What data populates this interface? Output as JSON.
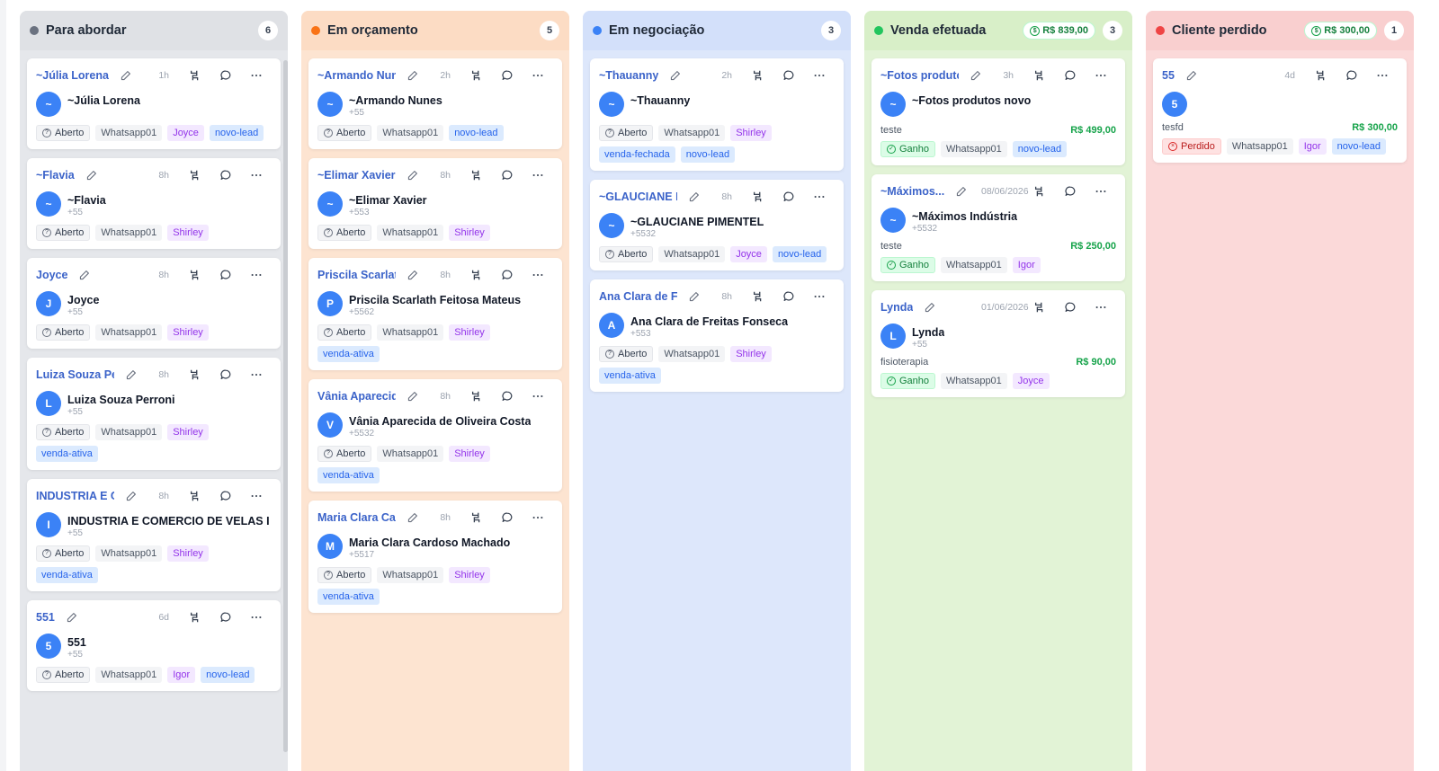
{
  "columns": [
    {
      "title": "Para abordar",
      "count": "6",
      "total": "",
      "dot_color": "#6b7280",
      "bg": "#e5e7eb",
      "head_bg": "#dfe1e5",
      "cards": [
        {
          "name": "~Júlia Lorena",
          "time": "1h",
          "avatar": "~",
          "contact": "~Júlia Lorena",
          "phone": "",
          "status": "Aberto",
          "connection": "Whatsapp01",
          "tags": [
            {
              "text": "Joyce",
              "kind": "user"
            },
            {
              "text": "novo-lead",
              "kind": "label"
            }
          ]
        },
        {
          "name": "~Flavia",
          "time": "8h",
          "avatar": "~",
          "contact": "~Flavia",
          "phone": "+55",
          "status": "Aberto",
          "connection": "Whatsapp01",
          "tags": [
            {
              "text": "Shirley",
              "kind": "user"
            }
          ]
        },
        {
          "name": "Joyce",
          "time": "8h",
          "avatar": "J",
          "contact": "Joyce",
          "phone": "+55",
          "status": "Aberto",
          "connection": "Whatsapp01",
          "tags": [
            {
              "text": "Shirley",
              "kind": "user"
            }
          ]
        },
        {
          "name": "Luiza Souza Perr...",
          "time": "8h",
          "avatar": "L",
          "contact": "Luiza Souza Perroni",
          "phone": "+55",
          "status": "Aberto",
          "connection": "Whatsapp01",
          "tags": [
            {
              "text": "Shirley",
              "kind": "user"
            },
            {
              "text": "venda-ativa",
              "kind": "label"
            }
          ]
        },
        {
          "name": "INDUSTRIA E CO...",
          "time": "8h",
          "avatar": "I",
          "contact": "INDUSTRIA E COMERCIO DE VELAS IR...",
          "phone": "+55",
          "status": "Aberto",
          "connection": "Whatsapp01",
          "tags": [
            {
              "text": "Shirley",
              "kind": "user"
            },
            {
              "text": "venda-ativa",
              "kind": "label"
            }
          ]
        },
        {
          "name": "551",
          "time": "6d",
          "avatar": "5",
          "contact": "551",
          "phone": "+55",
          "status": "Aberto",
          "connection": "Whatsapp01",
          "tags": [
            {
              "text": "Igor",
              "kind": "user"
            },
            {
              "text": "novo-lead",
              "kind": "label"
            }
          ]
        }
      ]
    },
    {
      "title": "Em orçamento",
      "count": "5",
      "total": "",
      "dot_color": "#f97316",
      "bg": "#fde4d1",
      "head_bg": "#fcdcc4",
      "cards": [
        {
          "name": "~Armando Nunes",
          "time": "2h",
          "avatar": "~",
          "contact": "~Armando Nunes",
          "phone": "+55",
          "status": "Aberto",
          "connection": "Whatsapp01",
          "tags": [
            {
              "text": "novo-lead",
              "kind": "label"
            }
          ]
        },
        {
          "name": "~Elimar Xavier",
          "time": "8h",
          "avatar": "~",
          "contact": "~Elimar Xavier",
          "phone": "+553",
          "status": "Aberto",
          "connection": "Whatsapp01",
          "tags": [
            {
              "text": "Shirley",
              "kind": "user"
            }
          ]
        },
        {
          "name": "Priscila Scarlath F...",
          "time": "8h",
          "avatar": "P",
          "contact": "Priscila Scarlath Feitosa Mateus",
          "phone": "+5562",
          "status": "Aberto",
          "connection": "Whatsapp01",
          "tags": [
            {
              "text": "Shirley",
              "kind": "user"
            },
            {
              "text": "venda-ativa",
              "kind": "label"
            }
          ]
        },
        {
          "name": "Vânia Aparecida d...",
          "time": "8h",
          "avatar": "V",
          "contact": "Vânia Aparecida de Oliveira Costa",
          "phone": "+5532",
          "status": "Aberto",
          "connection": "Whatsapp01",
          "tags": [
            {
              "text": "Shirley",
              "kind": "user"
            },
            {
              "text": "venda-ativa",
              "kind": "label"
            }
          ]
        },
        {
          "name": "Maria Clara Cardo...",
          "time": "8h",
          "avatar": "M",
          "contact": "Maria Clara Cardoso Machado",
          "phone": "+5517",
          "status": "Aberto",
          "connection": "Whatsapp01",
          "tags": [
            {
              "text": "Shirley",
              "kind": "user"
            },
            {
              "text": "venda-ativa",
              "kind": "label"
            }
          ]
        }
      ]
    },
    {
      "title": "Em negociação",
      "count": "3",
      "total": "",
      "dot_color": "#3b82f6",
      "bg": "#dde7fb",
      "head_bg": "#d3e0fa",
      "cards": [
        {
          "name": "~Thauanny",
          "time": "2h",
          "avatar": "~",
          "contact": "~Thauanny",
          "phone": "",
          "status": "Aberto",
          "connection": "Whatsapp01",
          "tags": [
            {
              "text": "Shirley",
              "kind": "user"
            },
            {
              "text": "venda-fechada",
              "kind": "label"
            },
            {
              "text": "novo-lead",
              "kind": "label"
            }
          ]
        },
        {
          "name": "~GLAUCIANE PIM...",
          "time": "8h",
          "avatar": "~",
          "contact": "~GLAUCIANE PIMENTEL",
          "phone": "+5532",
          "status": "Aberto",
          "connection": "Whatsapp01",
          "tags": [
            {
              "text": "Joyce",
              "kind": "user"
            },
            {
              "text": "novo-lead",
              "kind": "label"
            }
          ]
        },
        {
          "name": "Ana Clara de Freit...",
          "time": "8h",
          "avatar": "A",
          "contact": "Ana Clara de Freitas Fonseca",
          "phone": "+553",
          "status": "Aberto",
          "connection": "Whatsapp01",
          "tags": [
            {
              "text": "Shirley",
              "kind": "user"
            },
            {
              "text": "venda-ativa",
              "kind": "label"
            }
          ]
        }
      ]
    },
    {
      "title": "Venda efetuada",
      "count": "3",
      "total": "R$ 839,00",
      "dot_color": "#22c55e",
      "bg": "#e2f3d6",
      "head_bg": "#d8efc8",
      "cards": [
        {
          "name": "~Fotos produtos ...",
          "time": "3h",
          "avatar": "~",
          "contact": "~Fotos produtos novo",
          "phone": "",
          "deal_desc": "teste",
          "deal_value": "R$ 499,00",
          "status": "Ganho",
          "connection": "Whatsapp01",
          "tags": [
            {
              "text": "novo-lead",
              "kind": "label"
            }
          ]
        },
        {
          "name": "~Máximos...",
          "time": "08/06/2026",
          "avatar": "~",
          "contact": "~Máximos Indústria",
          "phone": "+5532",
          "deal_desc": "teste",
          "deal_value": "R$ 250,00",
          "status": "Ganho",
          "connection": "Whatsapp01",
          "tags": [
            {
              "text": "Igor",
              "kind": "user"
            }
          ]
        },
        {
          "name": "Lynda",
          "time": "01/06/2026",
          "avatar": "L",
          "contact": "Lynda",
          "phone": "+55",
          "deal_desc": "fisioterapia",
          "deal_value": "R$ 90,00",
          "status": "Ganho",
          "connection": "Whatsapp01",
          "tags": [
            {
              "text": "Joyce",
              "kind": "user"
            }
          ]
        }
      ]
    },
    {
      "title": "Cliente perdido",
      "count": "1",
      "total": "R$ 300,00",
      "dot_color": "#ef4444",
      "bg": "#fbd9d9",
      "head_bg": "#f9cfcf",
      "cards": [
        {
          "name": "55",
          "time": "4d",
          "avatar": "5",
          "contact": "",
          "phone": "",
          "deal_desc": "tesfd",
          "deal_value": "R$ 300,00",
          "status": "Perdido",
          "connection": "Whatsapp01",
          "tags": [
            {
              "text": "Igor",
              "kind": "user"
            },
            {
              "text": "novo-lead",
              "kind": "label"
            }
          ]
        }
      ]
    }
  ]
}
